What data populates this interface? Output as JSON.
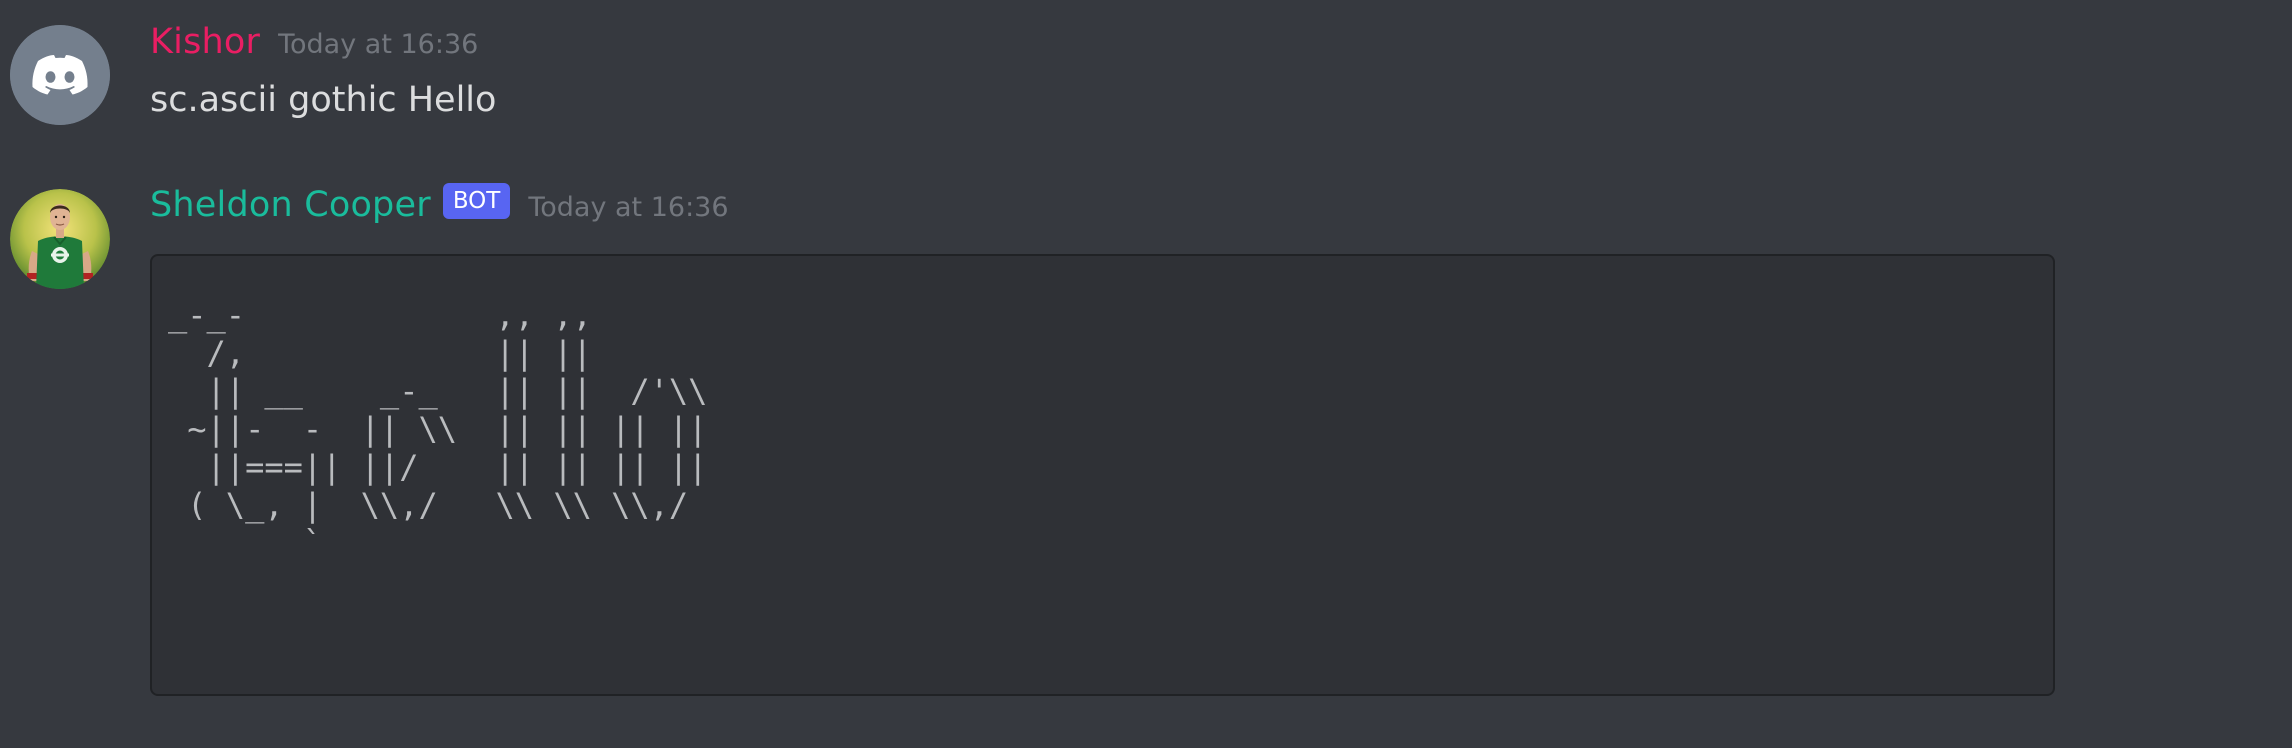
{
  "messages": [
    {
      "author": "Kishor",
      "author_color": "#e91e63",
      "timestamp": "Today at 16:36",
      "avatar_icon": "discord-logo-icon",
      "content": "sc.ascii gothic Hello"
    },
    {
      "author": "Sheldon Cooper",
      "author_color": "#1abc9c",
      "bot_tag": "BOT",
      "timestamp": "Today at 16:36",
      "avatar_icon": "sheldon-avatar-image",
      "code": "_-_-             ,, ,,\n  /,             || ||\n  || __    _-_   || ||  /'\\\\\n ~||-  -  || \\\\  || || || ||\n  ||===|| ||/    || || || ||\n ( \\_, |  \\\\,/   \\\\ \\\\ \\\\,/\n       `"
    }
  ],
  "colors": {
    "background": "#36393f",
    "codeblock_bg": "#2f3136",
    "text": "#dcddde",
    "muted": "#72767d",
    "bot_tag": "#5865f2"
  }
}
